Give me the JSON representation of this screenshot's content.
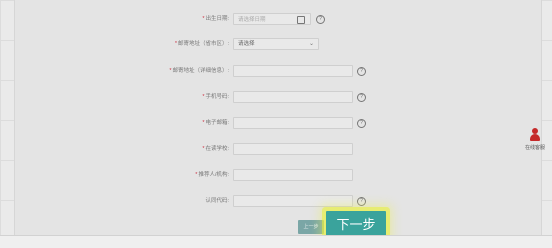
{
  "form": {
    "birth_date": {
      "label": "出生日期:",
      "placeholder": "请选择日期"
    },
    "address_region": {
      "label": "邮寄地址（省市区）:",
      "value": "请选择"
    },
    "address_detail": {
      "label": "邮寄地址（详细信息）:"
    },
    "phone": {
      "label": "手机号码:"
    },
    "email": {
      "label": "电子邮箱:"
    },
    "school": {
      "label": "在读学校:"
    },
    "referrer": {
      "label": "推荐人/机构:"
    },
    "sync_code": {
      "label": "认同代码:"
    },
    "required_mark": "*"
  },
  "buttons": {
    "prev": "上一步",
    "next": "下一步"
  },
  "service": {
    "label": "在线客服"
  },
  "colors": {
    "accent": "#3aa39c",
    "highlight": "#e8f03c",
    "service_icon": "#c52a2a"
  }
}
